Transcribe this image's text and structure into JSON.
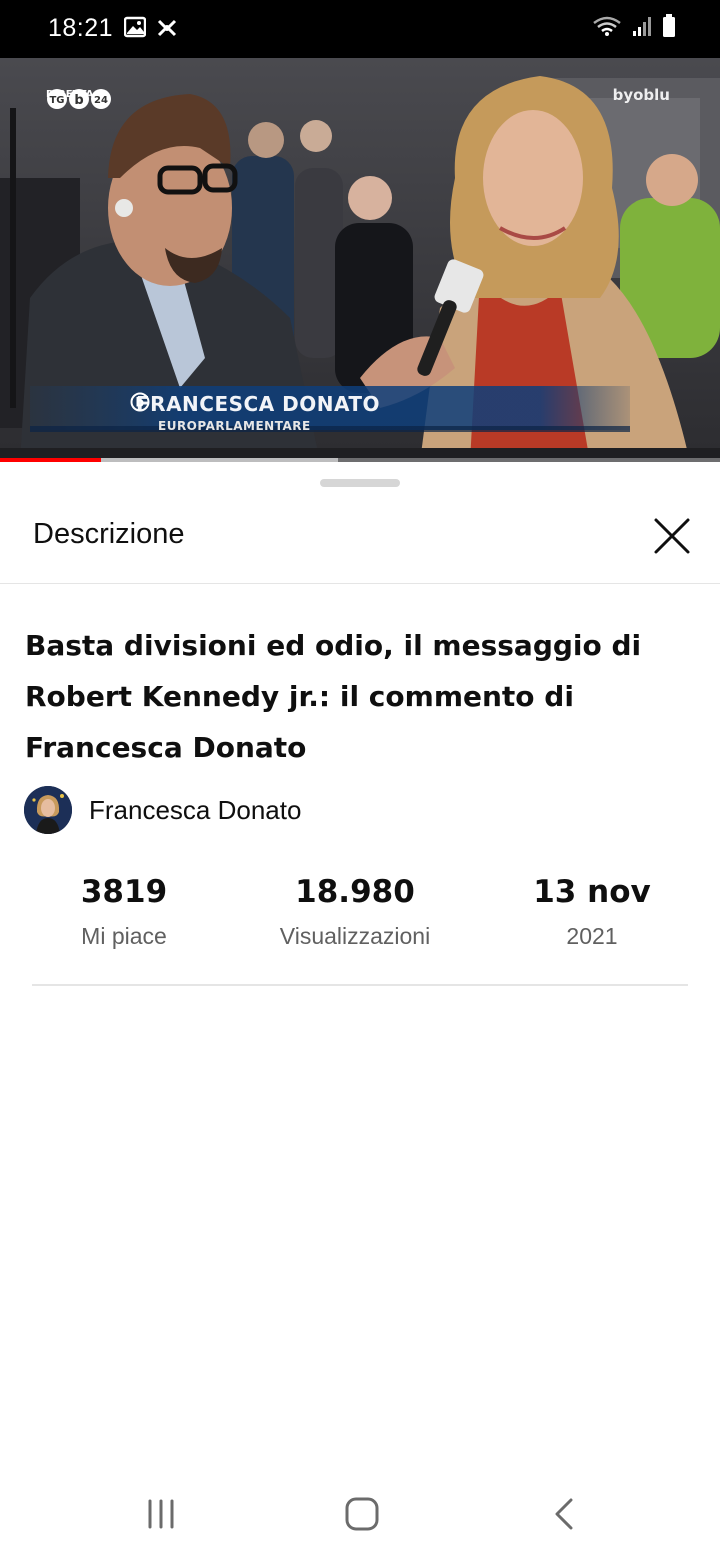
{
  "status_bar": {
    "time": "18:21",
    "left_icons": [
      "image-icon",
      "app-notification-icon"
    ],
    "right_icons": [
      "wifi-icon",
      "signal-icon",
      "battery-icon"
    ]
  },
  "video": {
    "caption_name": "FRANCESCA DONATO",
    "caption_role": "EUROPARLAMENTARE",
    "logo_top_left": "DIRETTA",
    "logo_top_right": "byoblu",
    "progress_fraction": 0.14,
    "buffer_fraction": 0.47,
    "progress_color": "#ff0000"
  },
  "sheet": {
    "title": "Descrizione",
    "close_icon": "close-icon"
  },
  "description": {
    "title": "Basta divisioni ed odio, il messaggio di Robert Kennedy jr.: il commento di Francesca Donato",
    "channel_name": "Francesca Donato"
  },
  "stats": [
    {
      "value": "3819",
      "label": "Mi piace"
    },
    {
      "value": "18.980",
      "label": "Visualizzazioni"
    },
    {
      "value": "13 nov",
      "label": "2021"
    }
  ],
  "nav_bar": {
    "icons": [
      "recent-apps-icon",
      "home-icon",
      "back-icon"
    ]
  }
}
